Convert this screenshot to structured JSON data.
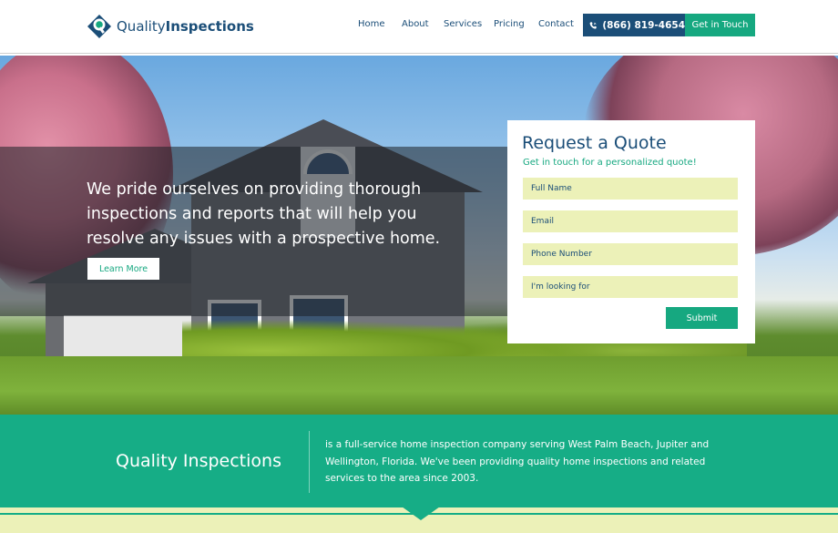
{
  "header": {
    "logo": {
      "text_light": "Quality",
      "text_bold": "Inspections"
    },
    "nav": [
      "Home",
      "About",
      "Services",
      "Pricing",
      "Contact"
    ],
    "phone": "(866) 819-4654",
    "cta": "Get in Touch"
  },
  "hero": {
    "headline": "We pride ourselves on providing thorough inspections and reports that will help you resolve any issues with a prospective home.",
    "button": "Learn More"
  },
  "quote_form": {
    "title": "Request a Quote",
    "subtitle": "Get in touch for a personalized quote!",
    "fields": [
      {
        "placeholder": "Full Name"
      },
      {
        "placeholder": "Email"
      },
      {
        "placeholder": "Phone Number"
      },
      {
        "placeholder": "I'm looking for"
      }
    ],
    "submit": "Submit"
  },
  "info_band": {
    "title": "Quality Inspections",
    "description": "is a full-service home inspection company serving West Palm Beach, Jupiter and Wellington, Florida. We've been providing quality home inspections and related services to the area since 2003."
  },
  "colors": {
    "navy": "#1b4e78",
    "green": "#16a880",
    "field_bg": "#ecf1b8"
  },
  "icons": [
    "logo-mark-icon",
    "phone-icon",
    "down-arrow-notch"
  ]
}
